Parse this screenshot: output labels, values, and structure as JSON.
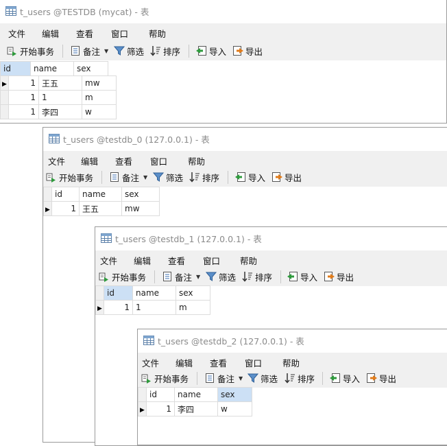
{
  "menu": {
    "file": "文件",
    "edit": "编辑",
    "view": "查看",
    "window": "窗口",
    "help": "帮助"
  },
  "toolbar": {
    "begin": "开始事务",
    "note": "备注",
    "filter": "筛选",
    "sort": "排序",
    "import": "导入",
    "export": "导出"
  },
  "columns": [
    "id",
    "name",
    "sex"
  ],
  "windows": [
    {
      "title": "t_users @TESTDB (mycat) - 表",
      "rows": [
        {
          "id": "1",
          "name": "王五",
          "sex": "mw"
        },
        {
          "id": "1",
          "name": "1",
          "sex": "m"
        },
        {
          "id": "1",
          "name": "李四",
          "sex": "w"
        }
      ]
    },
    {
      "title": "t_users @testdb_0 (127.0.0.1) - 表",
      "rows": [
        {
          "id": "1",
          "name": "王五",
          "sex": "mw"
        }
      ]
    },
    {
      "title": "t_users @testdb_1 (127.0.0.1) - 表",
      "rows": [
        {
          "id": "1",
          "name": "1",
          "sex": "m"
        }
      ]
    },
    {
      "title": "t_users @testdb_2 (127.0.0.1) - 表",
      "rows": [
        {
          "id": "1",
          "name": "李四",
          "sex": "w"
        }
      ]
    }
  ],
  "icons": {
    "table": "table-icon",
    "begin": "begin-transaction-icon",
    "note": "note-icon",
    "filter": "filter-icon",
    "sort": "sort-icon",
    "import": "import-icon",
    "export": "export-icon"
  },
  "colors": {
    "accent_green": "#2e9a3c",
    "accent_orange": "#e07b1a",
    "header_selected": "#cce0f5",
    "bar_bg": "#f0f0f0"
  }
}
